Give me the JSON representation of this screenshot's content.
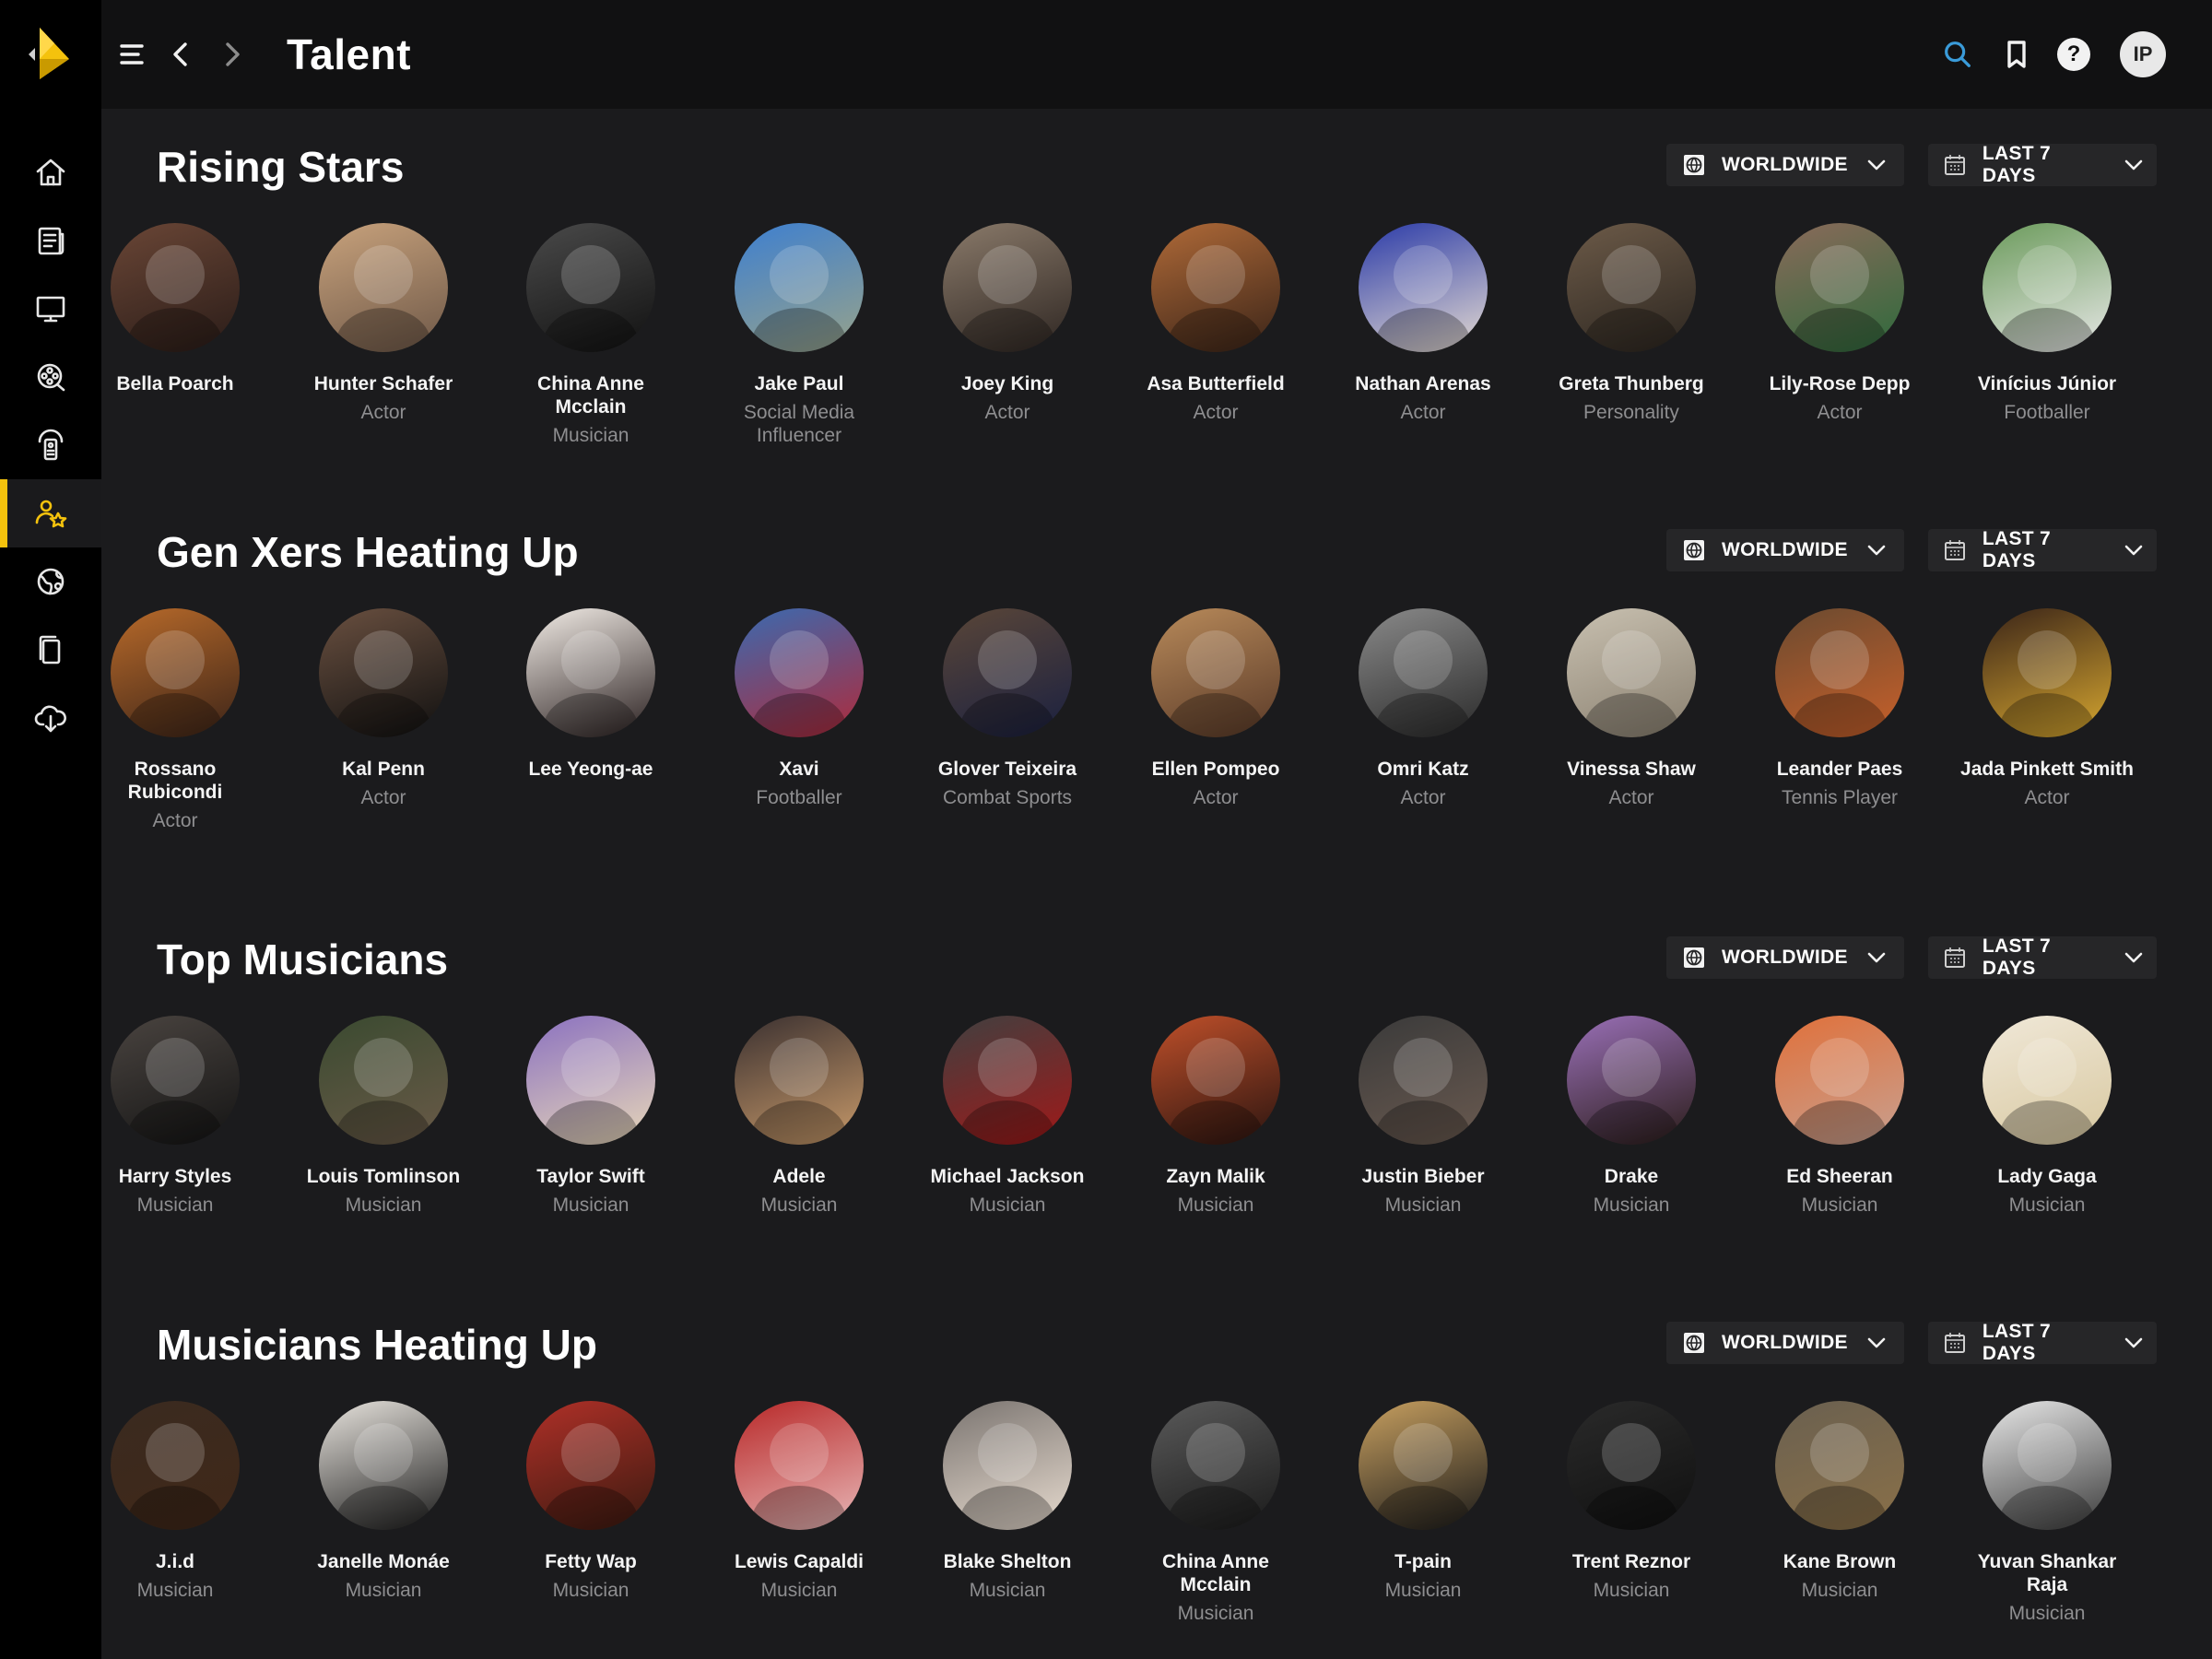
{
  "header": {
    "title": "Talent",
    "avatar_initials": "IP",
    "help_glyph": "?"
  },
  "sidebar": {
    "items": [
      {
        "icon": "home-icon",
        "active": false
      },
      {
        "icon": "news-icon",
        "active": false
      },
      {
        "icon": "tv-icon",
        "active": false
      },
      {
        "icon": "film-reel-icon",
        "active": false
      },
      {
        "icon": "remote-icon",
        "active": false
      },
      {
        "icon": "talent-star-icon",
        "active": true
      },
      {
        "icon": "globe-icon",
        "active": false
      },
      {
        "icon": "documents-icon",
        "active": false
      },
      {
        "icon": "cloud-download-icon",
        "active": false
      }
    ]
  },
  "colors": {
    "accent": "#f4c20d",
    "search": "#3a9bd9",
    "background": "#1b1b1d",
    "sidebar": "#000000",
    "topbar": "#111112"
  },
  "sections": [
    {
      "title": "Rising Stars",
      "region_label": "WORLDWIDE",
      "period_label": "LAST 7 DAYS",
      "people": [
        {
          "name": "Bella Poarch",
          "role": ""
        },
        {
          "name": "Hunter Schafer",
          "role": "Actor"
        },
        {
          "name": "China Anne Mcclain",
          "role": "Musician"
        },
        {
          "name": "Jake Paul",
          "role": "Social Media Influencer"
        },
        {
          "name": "Joey King",
          "role": "Actor"
        },
        {
          "name": "Asa Butterfield",
          "role": "Actor"
        },
        {
          "name": "Nathan Arenas",
          "role": "Actor"
        },
        {
          "name": "Greta Thunberg",
          "role": "Personality"
        },
        {
          "name": "Lily-Rose Depp",
          "role": "Actor"
        },
        {
          "name": "Vinícius Júnior",
          "role": "Footballer"
        }
      ]
    },
    {
      "title": "Gen Xers Heating Up",
      "region_label": "WORLDWIDE",
      "period_label": "LAST 7 DAYS",
      "people": [
        {
          "name": "Rossano Rubicondi",
          "role": "Actor"
        },
        {
          "name": "Kal Penn",
          "role": "Actor"
        },
        {
          "name": "Lee Yeong-ae",
          "role": ""
        },
        {
          "name": "Xavi",
          "role": "Footballer"
        },
        {
          "name": "Glover Teixeira",
          "role": "Combat Sports"
        },
        {
          "name": "Ellen Pompeo",
          "role": "Actor"
        },
        {
          "name": "Omri Katz",
          "role": "Actor"
        },
        {
          "name": "Vinessa Shaw",
          "role": "Actor"
        },
        {
          "name": "Leander Paes",
          "role": "Tennis Player"
        },
        {
          "name": "Jada Pinkett Smith",
          "role": "Actor"
        }
      ]
    },
    {
      "title": "Top Musicians",
      "region_label": "WORLDWIDE",
      "period_label": "LAST 7 DAYS",
      "people": [
        {
          "name": "Harry Styles",
          "role": "Musician"
        },
        {
          "name": "Louis Tomlinson",
          "role": "Musician"
        },
        {
          "name": "Taylor Swift",
          "role": "Musician"
        },
        {
          "name": "Adele",
          "role": "Musician"
        },
        {
          "name": "Michael Jackson",
          "role": "Musician"
        },
        {
          "name": "Zayn Malik",
          "role": "Musician"
        },
        {
          "name": "Justin Bieber",
          "role": "Musician"
        },
        {
          "name": "Drake",
          "role": "Musician"
        },
        {
          "name": "Ed Sheeran",
          "role": "Musician"
        },
        {
          "name": "Lady Gaga",
          "role": "Musician"
        }
      ]
    },
    {
      "title": "Musicians Heating Up",
      "region_label": "WORLDWIDE",
      "period_label": "LAST 7 DAYS",
      "people": [
        {
          "name": "J.i.d",
          "role": "Musician"
        },
        {
          "name": "Janelle Monáe",
          "role": "Musician"
        },
        {
          "name": "Fetty Wap",
          "role": "Musician"
        },
        {
          "name": "Lewis Capaldi",
          "role": "Musician"
        },
        {
          "name": "Blake Shelton",
          "role": "Musician"
        },
        {
          "name": "China Anne Mcclain",
          "role": "Musician"
        },
        {
          "name": "T-pain",
          "role": "Musician"
        },
        {
          "name": "Trent Reznor",
          "role": "Musician"
        },
        {
          "name": "Kane Brown",
          "role": "Musician"
        },
        {
          "name": "Yuvan Shankar Raja",
          "role": "Musician"
        }
      ]
    }
  ]
}
